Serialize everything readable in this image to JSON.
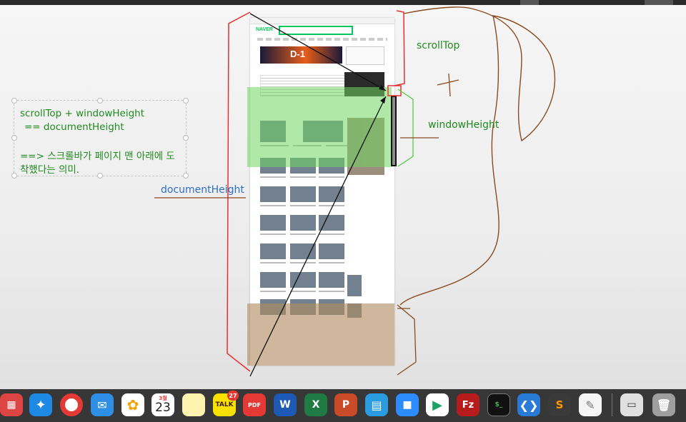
{
  "annotations": {
    "scroll_top": "scrollTop",
    "window_height": "windowHeight",
    "document_height": "documentHeight",
    "note_line1": "scrollTop + windowHeight",
    "note_line2": "== documentHeight",
    "note_line3": "==> 스크롤바가 페이지 맨 아래에 도",
    "note_line4": "착했다는 의미."
  },
  "webpage": {
    "logo": "NAVER",
    "banner_text": "D-1"
  },
  "colors": {
    "scroll_top_text": "#1f8a1f",
    "window_height_text": "#1f8a1f",
    "document_height_text": "#2d6fc4",
    "note_text": "#1f8a1f",
    "frame_red": "#e53030",
    "green_overlay": "#70d660",
    "tan_overlay": "#b08a60",
    "pen_brown": "#8a4a20",
    "naver_green": "#03c75a"
  },
  "dock": {
    "apps": [
      {
        "name": "launchpad-icon",
        "label": ""
      },
      {
        "name": "safari-icon",
        "label": ""
      },
      {
        "name": "chrome-icon",
        "label": ""
      },
      {
        "name": "mail-icon",
        "label": ""
      },
      {
        "name": "photos-icon",
        "label": ""
      },
      {
        "name": "calendar-icon",
        "label": "23",
        "month": "3월"
      },
      {
        "name": "notes-icon",
        "label": ""
      },
      {
        "name": "kakaotalk-icon",
        "label": "TALK",
        "badge": "27"
      },
      {
        "name": "pdf-expert-icon",
        "label": "PDF"
      },
      {
        "name": "word-icon",
        "label": "W"
      },
      {
        "name": "excel-icon",
        "label": "X"
      },
      {
        "name": "powerpoint-icon",
        "label": "P"
      },
      {
        "name": "archive-icon",
        "label": ""
      },
      {
        "name": "zoom-icon",
        "label": ""
      },
      {
        "name": "play-store-icon",
        "label": ""
      },
      {
        "name": "filezilla-icon",
        "label": "Fz"
      },
      {
        "name": "terminal-icon",
        "label": "$_"
      },
      {
        "name": "vscode-icon",
        "label": ""
      },
      {
        "name": "sublime-icon",
        "label": "S"
      },
      {
        "name": "textedit-icon",
        "label": ""
      },
      {
        "name": "preview-icon",
        "label": ""
      },
      {
        "name": "trash-icon",
        "label": ""
      }
    ]
  }
}
